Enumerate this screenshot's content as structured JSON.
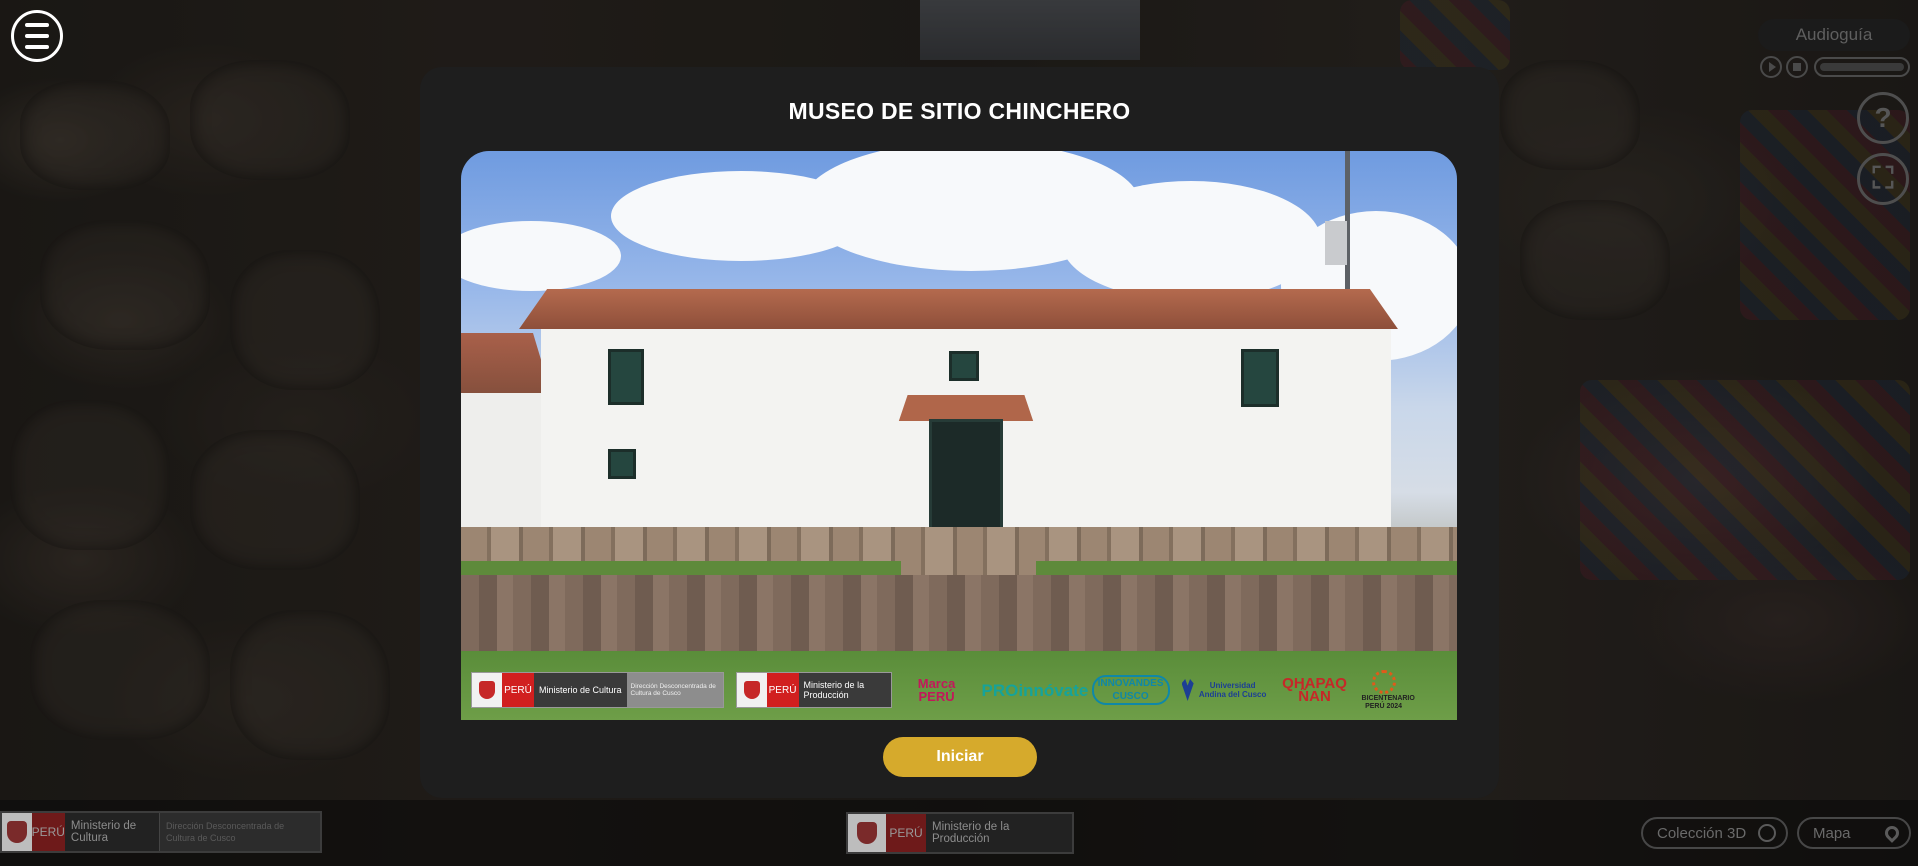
{
  "modal": {
    "title": "MUSEO DE SITIO CHINCHERO",
    "start_button": "Iniciar",
    "sponsors": {
      "cultura_peru": "PERÚ",
      "cultura_name": "Ministerio de Cultura",
      "cultura_sub": "Dirección Desconcentrada de Cultura de Cusco",
      "produccion_peru": "PERÚ",
      "produccion_name": "Ministerio de la Producción",
      "promperu": "Marca PERÚ",
      "proinnovate": "PROinnóvate",
      "innovandes": "INNOVANDES CUSCO",
      "uandina": "Universidad Andina del Cusco",
      "qhapaq": "QHAPAQ ÑAN",
      "bicentenario": "BICENTENARIO PERÚ 2024"
    }
  },
  "audio_guide": {
    "label": "Audioguía",
    "progress": 0
  },
  "help": {
    "glyph": "?"
  },
  "fullscreen": {
    "glyph": "⛶"
  },
  "footer": {
    "cultura": {
      "peru": "PERÚ",
      "name": "Ministerio de Cultura",
      "sub": "Dirección Desconcentrada de Cultura de Cusco"
    },
    "produccion": {
      "peru": "PERÚ",
      "name": "Ministerio de la Producción"
    },
    "coleccion_3d": "Colección 3D",
    "mapa": "Mapa"
  },
  "colors": {
    "accent": "#d6aa2c",
    "modal_bg": "#1e1e1e"
  }
}
